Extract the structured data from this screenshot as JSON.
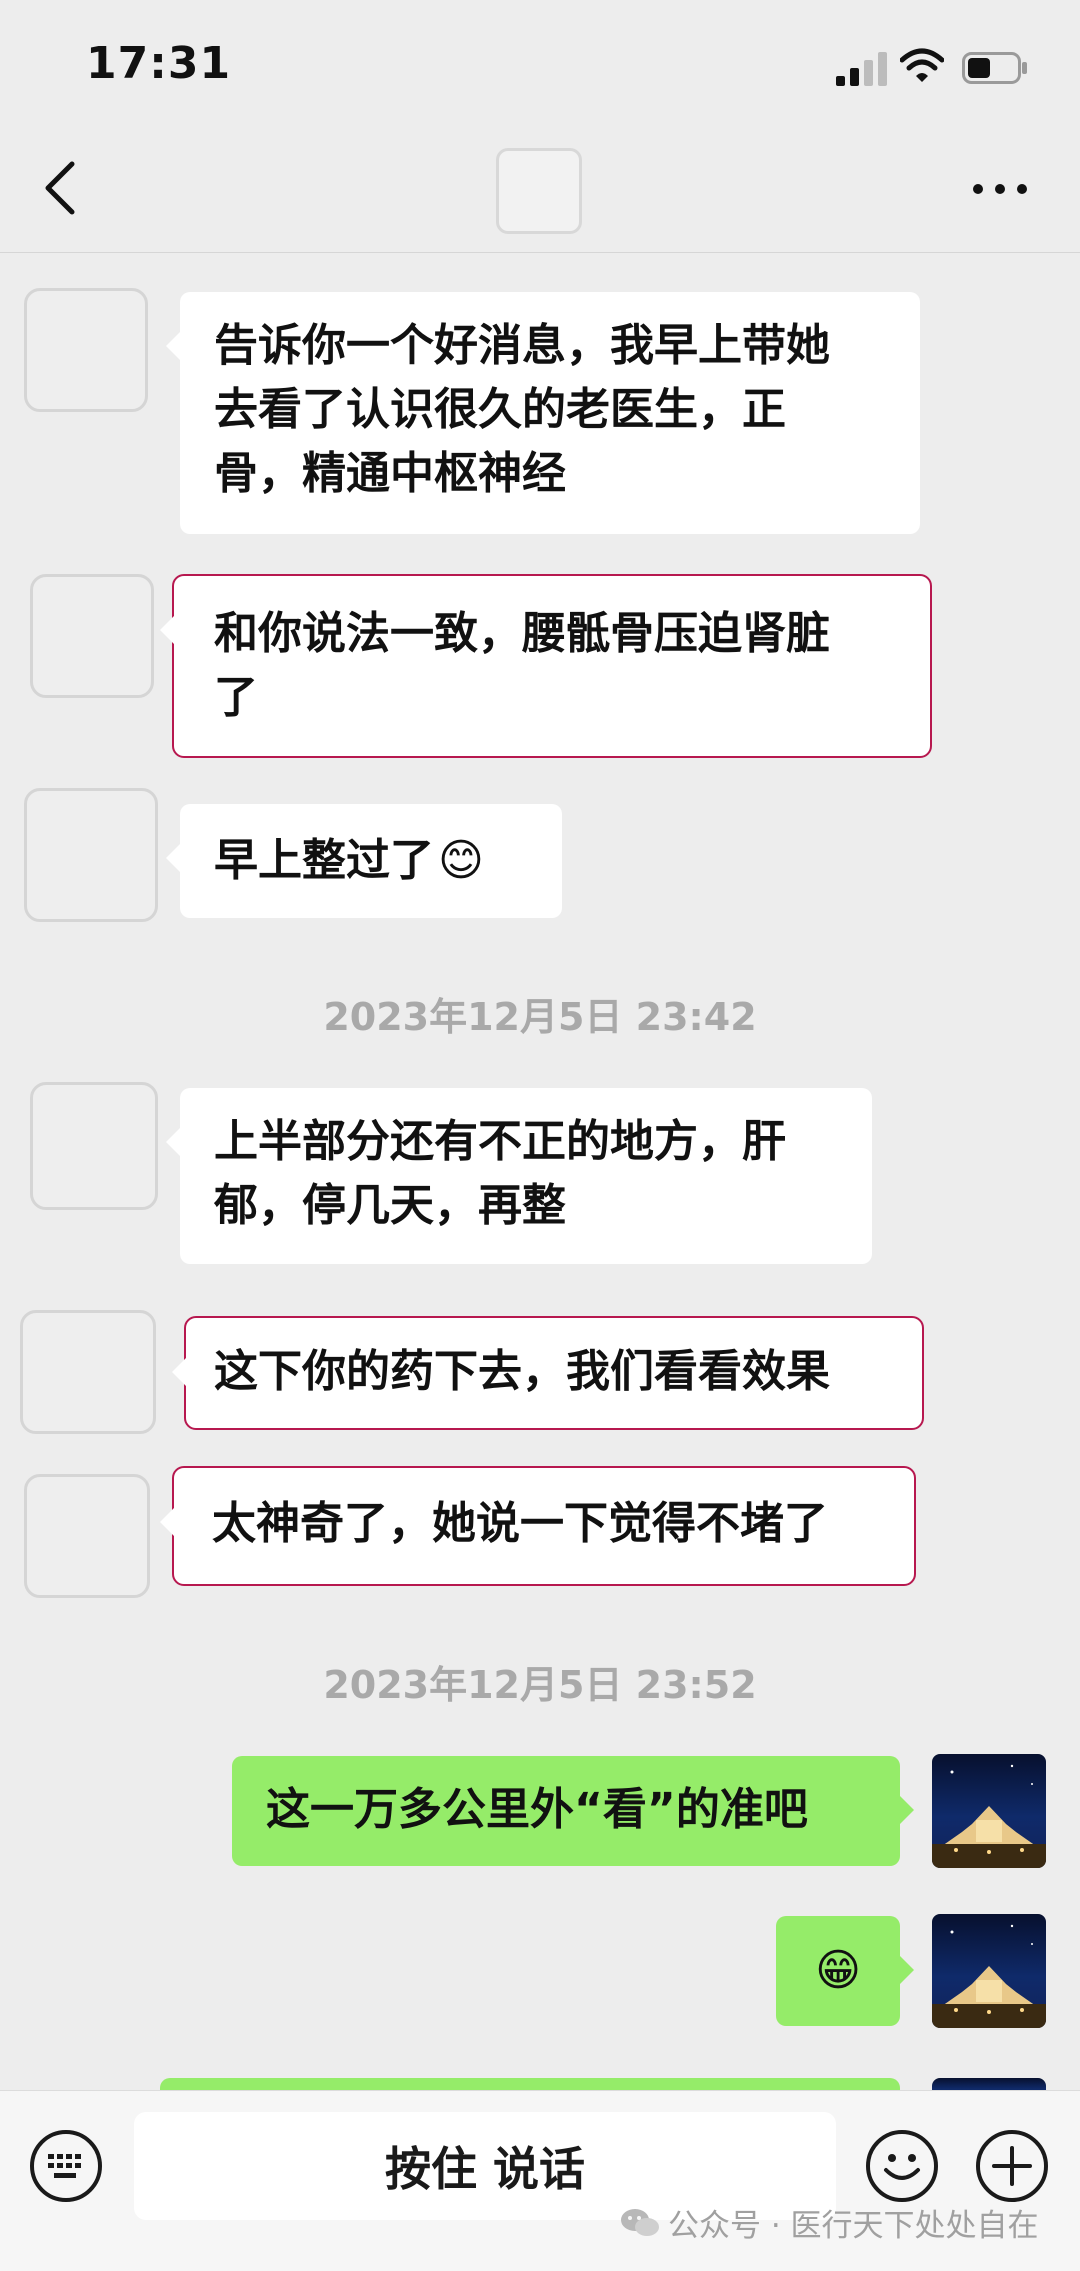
{
  "status_bar": {
    "time": "17:31"
  },
  "messages": [
    {
      "type": "in",
      "text_lines": [
        "告诉你一个好消息，我早上带她",
        "去看了认识很久的老医生，正",
        "骨，精通中枢神经"
      ]
    },
    {
      "type": "in",
      "text_lines": [
        "和你说法一致，腰骶骨压迫肾脏",
        "了"
      ],
      "highlighted": true
    },
    {
      "type": "in",
      "text": "早上整过了",
      "emoji": "😊"
    },
    {
      "type": "time",
      "text": "2023年12月5日 23:42"
    },
    {
      "type": "in",
      "text_lines": [
        "上半部分还有不正的地方，肝",
        "郁，停几天，再整"
      ]
    },
    {
      "type": "in",
      "text": "这下你的药下去，我们看看效果",
      "highlighted": true
    },
    {
      "type": "in",
      "text": "太神奇了，她说一下觉得不堵了",
      "highlighted": true
    },
    {
      "type": "time",
      "text": "2023年12月5日 23:52"
    },
    {
      "type": "out",
      "text": "这一万多公里外“看”的准吧"
    },
    {
      "type": "out",
      "emoji": "😁"
    }
  ],
  "input_bar": {
    "voice_label": "按住 说话"
  },
  "watermark": {
    "text": "公众号 · 医行天下处处自在"
  },
  "colors": {
    "background": "#ededed",
    "outgoing_bubble": "#95ec69",
    "incoming_bubble": "#ffffff",
    "highlight_border": "#b7184f"
  },
  "icons": [
    "back-icon",
    "more-icon",
    "keyboard-icon",
    "emoji-icon",
    "plus-icon",
    "signal-icon",
    "wifi-icon",
    "battery-icon",
    "wechat-icon"
  ]
}
